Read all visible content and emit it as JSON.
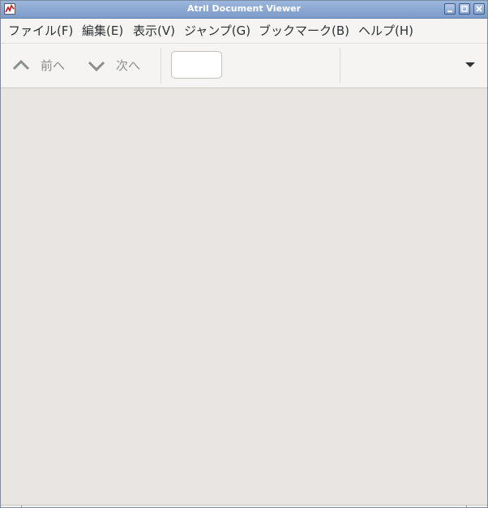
{
  "window": {
    "title": "Atril Document Viewer"
  },
  "titlebar_buttons": {
    "minimize": "▁",
    "maximize": "□",
    "close": "✕"
  },
  "menu": {
    "items": [
      {
        "label": "ファイル(F)"
      },
      {
        "label": "編集(E)"
      },
      {
        "label": "表示(V)"
      },
      {
        "label": "ジャンプ(G)"
      },
      {
        "label": "ブックマーク(B)"
      },
      {
        "label": "ヘルプ(H)"
      }
    ]
  },
  "toolbar": {
    "previous_label": "前へ",
    "next_label": "次へ",
    "page_value": "",
    "previous_icon": "chevron-up-icon",
    "next_icon": "chevron-down-icon",
    "menu_icon": "triangle-down-icon"
  },
  "colors": {
    "titlebar": "#8aa7d2",
    "toolbar_bg": "#f5f4f2",
    "document_bg": "#e8e5e2",
    "disabled_text": "#8b8e8f"
  }
}
